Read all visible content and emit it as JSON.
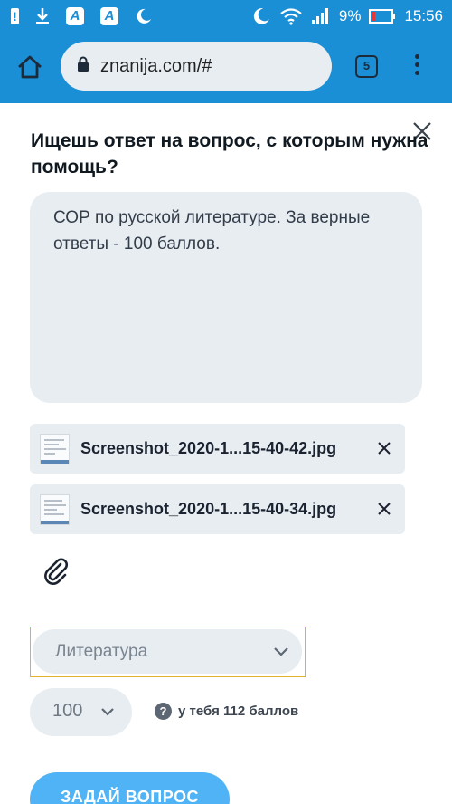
{
  "status_bar": {
    "battery_percent": "9%",
    "time": "15:56",
    "icons_left": [
      "alert-icon",
      "download-icon",
      "app-a-icon",
      "app-a-icon",
      "moon-icon"
    ],
    "icons_right": [
      "moon-icon",
      "wifi-icon",
      "signal-icon",
      "battery-icon"
    ]
  },
  "browser": {
    "url": "znanija.com/#",
    "tab_count": "5"
  },
  "form": {
    "heading": "Ищешь ответ на вопрос, с которым нужна помощь?",
    "question_text": "СОР по русской литературе. За верные ответы - 100 баллов.",
    "attachments": [
      {
        "name": "Screenshot_2020-1...15-40-42.jpg"
      },
      {
        "name": "Screenshot_2020-1...15-40-34.jpg"
      }
    ],
    "subject": "Литература",
    "points": "100",
    "points_note": "у тебя 112 баллов",
    "submit_label": "ЗАДАЙ ВОПРОС"
  },
  "colors": {
    "brand_blue": "#1a8fd6",
    "button_blue": "#4fb3f6",
    "field_bg": "#e8edf2",
    "focus_outline": "#e3b12a"
  }
}
